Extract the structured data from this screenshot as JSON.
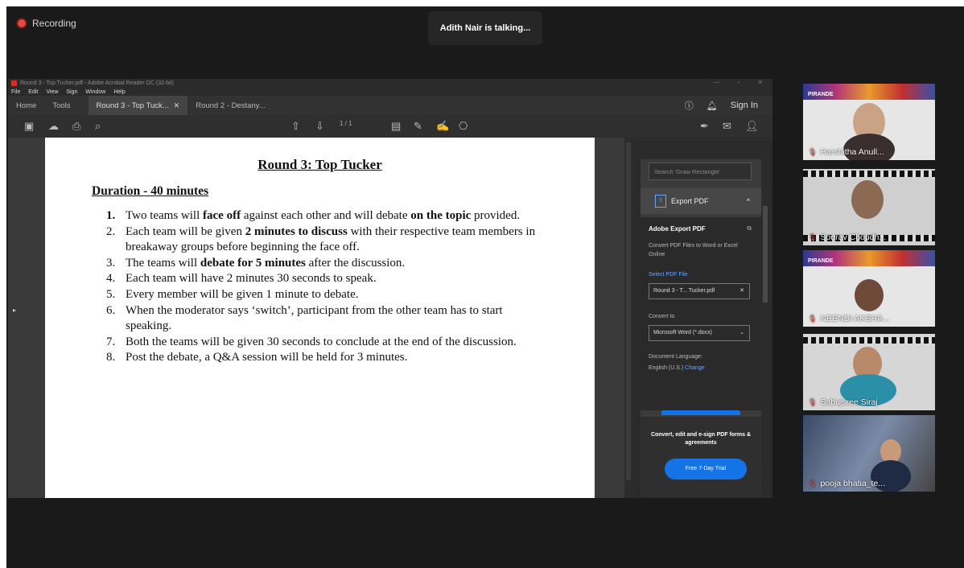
{
  "meeting": {
    "recording_label": "Recording",
    "talking_label": "Adith Nair is talking..."
  },
  "acrobat": {
    "window_title": "Round 3 - Top Tucker.pdf - Adobe Acrobat Reader DC (32-bit)",
    "menu": [
      "File",
      "Edit",
      "View",
      "Sign",
      "Window",
      "Help"
    ],
    "tabs": [
      {
        "label": "Home"
      },
      {
        "label": "Tools"
      },
      {
        "label": "Round 3 - Top Tuck...",
        "active": true
      },
      {
        "label": "Round 2 - Destany..."
      }
    ],
    "sign_in": "Sign In",
    "page_indicator": "1 / 1",
    "document": {
      "title": "Round 3: Top Tucker",
      "duration": "Duration - 40 minutes",
      "rules": [
        {
          "num": "1.",
          "parts": [
            {
              "t": "Two teams will "
            },
            {
              "t": "face off",
              "b": true
            },
            {
              "t": " against each other and will debate "
            },
            {
              "t": "on the topic",
              "b": true
            },
            {
              "t": " provided."
            }
          ]
        },
        {
          "num": "2.",
          "parts": [
            {
              "t": "Each team will be given "
            },
            {
              "t": "2 minutes to discuss",
              "b": true
            },
            {
              "t": " with their respective team members in breakaway groups before beginning the face off."
            }
          ]
        },
        {
          "num": "3.",
          "parts": [
            {
              "t": "The teams will "
            },
            {
              "t": "debate for 5 minutes",
              "b": true
            },
            {
              "t": " after the discussion."
            }
          ]
        },
        {
          "num": "4.",
          "parts": [
            {
              "t": "Each team will have 2 minutes 30 seconds to speak."
            }
          ]
        },
        {
          "num": "5.",
          "parts": [
            {
              "t": "Every member will be given 1 minute to debate."
            }
          ]
        },
        {
          "num": "6.",
          "parts": [
            {
              "t": "When the moderator says ‘switch’, participant from the other team has to start speaking."
            }
          ]
        },
        {
          "num": "7.",
          "parts": [
            {
              "t": "Both the teams will be given 30 seconds to conclude at the end of the discussion."
            }
          ]
        },
        {
          "num": "8.",
          "parts": [
            {
              "t": "Post the debate, a Q&A session will be held for 3 minutes."
            }
          ]
        }
      ]
    },
    "right_panel": {
      "search_placeholder": "Search 'Draw Rectangle'",
      "export_label": "Export PDF",
      "export_heading": "Adobe Export PDF",
      "export_desc": "Convert PDF Files to Word or Excel Online",
      "select_file_label": "Select PDF File",
      "selected_file": "Round 3 - T... Tucker.pdf",
      "convert_to_label": "Convert to",
      "convert_to_value": "Microsoft Word (*.docx)",
      "doc_language_label": "Document Language:",
      "doc_language_value": "English (U.S.)",
      "change_link": "Change",
      "promo_text": "Convert, edit and e-sign PDF forms & agreements",
      "trial_button": "Free 7-Day Trial"
    }
  },
  "participants": [
    {
      "name": "Harshitha Anull..."
    },
    {
      "name": "Sourav Choudh..."
    },
    {
      "name": "NEENDI AKSHA..."
    },
    {
      "name": "Sabujsree Siraj"
    },
    {
      "name": "pooja bhatia_te..."
    }
  ],
  "banner_text": "PIRANDE"
}
